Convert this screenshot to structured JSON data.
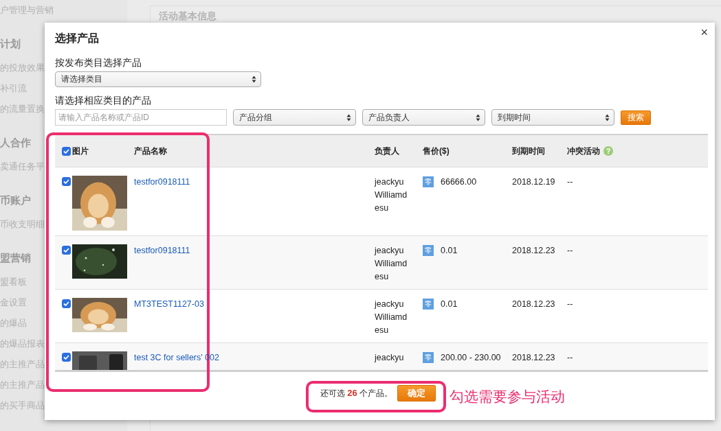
{
  "background": {
    "sidebar": [
      {
        "kind": "item",
        "label": "户管理与营销"
      },
      {
        "kind": "heading",
        "label": "计划"
      },
      {
        "kind": "item",
        "label": "的投放效果"
      },
      {
        "kind": "item",
        "label": "补引流"
      },
      {
        "kind": "item",
        "label": "的流量置换"
      },
      {
        "kind": "heading",
        "label": "人合作"
      },
      {
        "kind": "item",
        "label": "卖通任务平"
      },
      {
        "kind": "heading",
        "label": "币账户"
      },
      {
        "kind": "item",
        "label": "币收支明细"
      },
      {
        "kind": "heading",
        "label": "盟营销"
      },
      {
        "kind": "item",
        "label": "盟看板"
      },
      {
        "kind": "item",
        "label": "金设置"
      },
      {
        "kind": "item",
        "label": "的爆品"
      },
      {
        "kind": "item",
        "label": "的爆品报表"
      },
      {
        "kind": "item",
        "label": "的主推产品"
      },
      {
        "kind": "item",
        "label": "的主推产品"
      },
      {
        "kind": "item",
        "label": "的买手商品"
      }
    ],
    "section_title": "活动基本信息"
  },
  "dialog": {
    "title": "选择产品",
    "close": "×",
    "category_label": "按发布类目选择产品",
    "category_select": "请选择类目",
    "products_label": "请选择相应类目的产品",
    "search": {
      "placeholder": "请输入产品名称或产品ID"
    },
    "filters": [
      "产品分组",
      "产品负责人",
      "到期时间"
    ],
    "search_button": "搜索",
    "table": {
      "select_all": {
        "label": "图片",
        "checked": true
      },
      "columns": [
        "产品名称",
        "负责人",
        "售价($)",
        "到期时间",
        "冲突活动"
      ],
      "help": "?",
      "rows": [
        {
          "checked": true,
          "name": "testfor0918111",
          "owner": [
            "jeackyu",
            "Williamd",
            "esu"
          ],
          "price_badge": "零",
          "price": "66666.00",
          "expiry": "2018.12.19",
          "conflict": "--"
        },
        {
          "checked": true,
          "name": "testfor0918111",
          "owner": [
            "jeackyu",
            "Williamd",
            "esu"
          ],
          "price_badge": "零",
          "price": "0.01",
          "expiry": "2018.12.23",
          "conflict": "--"
        },
        {
          "checked": true,
          "name": "MT3TEST1127-03",
          "owner": [
            "jeackyu",
            "Williamd",
            "esu"
          ],
          "price_badge": "零",
          "price": "0.01",
          "expiry": "2018.12.23",
          "conflict": "--"
        },
        {
          "checked": true,
          "name": "test 3C for sellers' 002",
          "owner": [
            "jeackyu"
          ],
          "price_badge": "零",
          "price": "200.00 - 230.00",
          "expiry": "2018.12.23",
          "conflict": "--"
        }
      ]
    },
    "footer": {
      "remaining": "还可选 **26** 个产品。",
      "confirm": "确定"
    }
  },
  "annotation": "勾选需要参与活动"
}
